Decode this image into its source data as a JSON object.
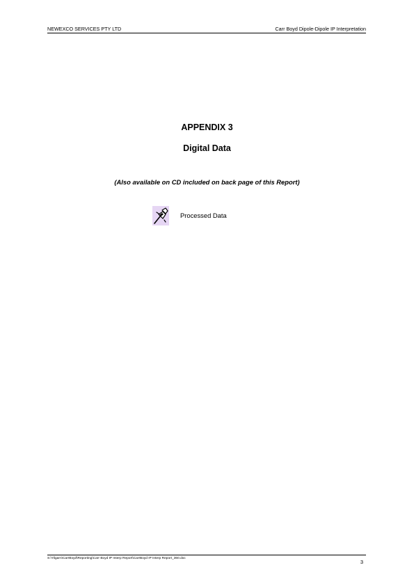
{
  "header": {
    "company": "NEWEXCO SERVICES PTY LTD",
    "report_title": "Carr Boyd Dipole-Dipole IP Interpretation"
  },
  "body": {
    "appendix_title": "APPENDIX 3",
    "section_title": "Digital Data",
    "subtitle": "(Also available on CD included on back page of this Report)",
    "attachment": {
      "icon": "pushpin-icon",
      "label": "Processed Data"
    }
  },
  "footer": {
    "file_path": "S:\\Yilgarn\\CarrBoyd\\Reporting\\Carr Boyd IP Interp Report\\CarrBoyd IP Interp Report_360.doc",
    "page_number": "3"
  }
}
